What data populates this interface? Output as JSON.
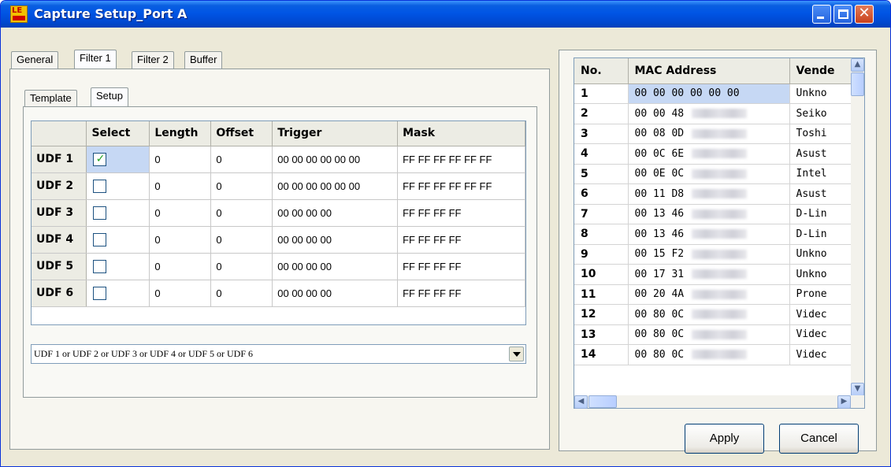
{
  "window": {
    "title": "Capture Setup_Port A",
    "app_icon_text": "LE"
  },
  "tabs": [
    {
      "label": "General",
      "active": false
    },
    {
      "label": "Filter 1",
      "active": true
    },
    {
      "label": "Filter 2",
      "active": false
    },
    {
      "label": "Buffer",
      "active": false
    }
  ],
  "subtabs": [
    {
      "label": "Template",
      "active": false
    },
    {
      "label": "Setup",
      "active": true
    }
  ],
  "udf_table": {
    "columns": [
      "",
      "Select",
      "Length",
      "Offset",
      "Trigger",
      "Mask"
    ],
    "rows": [
      {
        "name": "UDF 1",
        "selected": true,
        "length": "0",
        "offset": "0",
        "trigger": "00 00 00 00 00 00",
        "mask": "FF FF FF FF FF FF"
      },
      {
        "name": "UDF 2",
        "selected": false,
        "length": "0",
        "offset": "0",
        "trigger": "00 00 00 00 00 00",
        "mask": "FF FF FF FF FF FF"
      },
      {
        "name": "UDF 3",
        "selected": false,
        "length": "0",
        "offset": "0",
        "trigger": "00 00 00 00",
        "mask": "FF FF FF FF"
      },
      {
        "name": "UDF 4",
        "selected": false,
        "length": "0",
        "offset": "0",
        "trigger": "00 00 00 00",
        "mask": "FF FF FF FF"
      },
      {
        "name": "UDF 5",
        "selected": false,
        "length": "0",
        "offset": "0",
        "trigger": "00 00 00 00",
        "mask": "FF FF FF FF"
      },
      {
        "name": "UDF 6",
        "selected": false,
        "length": "0",
        "offset": "0",
        "trigger": "00 00 00 00",
        "mask": "FF FF FF FF"
      }
    ]
  },
  "condition_combo": {
    "value": "UDF 1 or UDF 2 or UDF 3 or UDF 4 or UDF 5 or UDF 6"
  },
  "mac_table": {
    "columns": [
      "No.",
      "MAC Address",
      "Vende"
    ],
    "rows": [
      {
        "no": "1",
        "mac": "00 00 00 00 00 00",
        "vendor": "Unkno"
      },
      {
        "no": "2",
        "mac": "00 00 48",
        "vendor": "Seiko"
      },
      {
        "no": "3",
        "mac": "00 08 0D",
        "vendor": "Toshi"
      },
      {
        "no": "4",
        "mac": "00 0C 6E",
        "vendor": "Asust"
      },
      {
        "no": "5",
        "mac": "00 0E 0C",
        "vendor": "Intel"
      },
      {
        "no": "6",
        "mac": "00 11 D8",
        "vendor": "Asust"
      },
      {
        "no": "7",
        "mac": "00 13 46",
        "vendor": "D-Lin"
      },
      {
        "no": "8",
        "mac": "00 13 46",
        "vendor": "D-Lin"
      },
      {
        "no": "9",
        "mac": "00 15 F2",
        "vendor": "Unkno"
      },
      {
        "no": "10",
        "mac": "00 17 31",
        "vendor": "Unkno"
      },
      {
        "no": "11",
        "mac": "00 20 4A",
        "vendor": "Prone"
      },
      {
        "no": "12",
        "mac": "00 80 0C",
        "vendor": "Videc"
      },
      {
        "no": "13",
        "mac": "00 80 0C",
        "vendor": "Videc"
      },
      {
        "no": "14",
        "mac": "00 80 0C",
        "vendor": "Videc"
      }
    ]
  },
  "buttons": {
    "apply": "Apply",
    "cancel": "Cancel"
  },
  "icons": {
    "minimize": "minimize-icon",
    "maximize": "maximize-icon",
    "close": "close-icon",
    "check": "check-icon",
    "dropdown": "chevron-down-icon",
    "scroll_up": "chevron-up-icon",
    "scroll_down": "chevron-down-icon",
    "scroll_left": "chevron-left-icon",
    "scroll_right": "chevron-right-icon"
  },
  "colors": {
    "title_bar": "#0055e5",
    "selection": "#c6d8f4",
    "check_mark": "#21a121",
    "window_bg": "#ece9d8"
  }
}
